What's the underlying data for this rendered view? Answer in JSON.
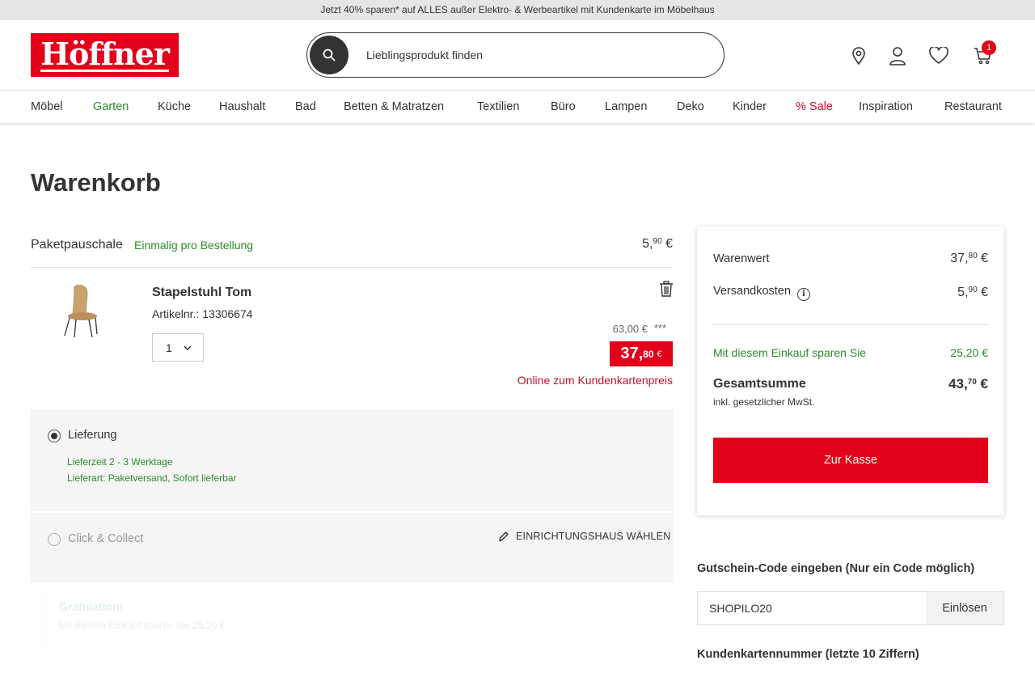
{
  "promo": {
    "text": "Jetzt 40% sparen* auf ALLES außer Elektro- & Werbeartikel mit Kundenkarte im Möbelhaus"
  },
  "header": {
    "logo": "Höffner",
    "search_placeholder": "Lieblingsprodukt finden",
    "cart_count": "1",
    "icons": [
      "search-icon",
      "location-pin-icon",
      "user-icon",
      "heart-icon",
      "cart-icon"
    ]
  },
  "nav": [
    "Möbel",
    "Garten",
    "Küche",
    "Haushalt",
    "Bad",
    "Betten & Matratzen",
    "Textilien",
    "Büro",
    "Lampen",
    "Deko",
    "Kinder",
    "% Sale",
    "Inspiration",
    "Restaurant"
  ],
  "colors": {
    "brand": "#e2001a",
    "green": "#2b8a2b",
    "sale_text": "#c8102e",
    "panel": "#f5f5f5"
  },
  "page": {
    "title": "Warenkorb"
  },
  "package": {
    "label": "Paketpauschale",
    "note": "Einmalig pro Bestellung",
    "price_main": "5,",
    "price_cents": "90",
    "currency": "€"
  },
  "item": {
    "name": "Stapelstuhl Tom",
    "article": "Artikelnr.: 13306674",
    "quantity": "1",
    "old_price": "63,00 €",
    "stars": "***",
    "price_main": "37,",
    "price_cents": "80",
    "currency": "€",
    "note": "Online zum Kundenkartenpreis"
  },
  "delivery": {
    "label": "Lieferung",
    "time": "Lieferzeit 2 - 3 Werktage",
    "type": "Lieferart: Paketversand, Sofort lieferbar"
  },
  "collect": {
    "label": "Click & Collect",
    "link": "EINRICHTUNGSHAUS WÄHLEN"
  },
  "faded": {
    "title": "Gratulation!",
    "text": "Mit diesem Einkauf sparen Sie 25,20 €"
  },
  "summary": {
    "goods_label": "Warenwert",
    "goods_main": "37,",
    "goods_cents": "80",
    "goods_cur": "€",
    "shipping_label": "Versandkosten",
    "shipping_main": "5,",
    "shipping_cents": "90",
    "shipping_cur": "€",
    "savings_label": "Mit diesem Einkauf sparen Sie",
    "savings_value": "25,20 €",
    "total_label": "Gesamtsumme",
    "total_main": "43,",
    "total_cents": "70",
    "total_cur": "€",
    "vat_note": "inkl. gesetzlicher MwSt.",
    "checkout": "Zur Kasse"
  },
  "coupon": {
    "title": "Gutschein-Code eingeben (Nur ein Code möglich)",
    "value": "SHOPILO20",
    "button": "Einlösen"
  },
  "card": {
    "title": "Kundenkartennummer (letzte 10 Ziffern)"
  }
}
